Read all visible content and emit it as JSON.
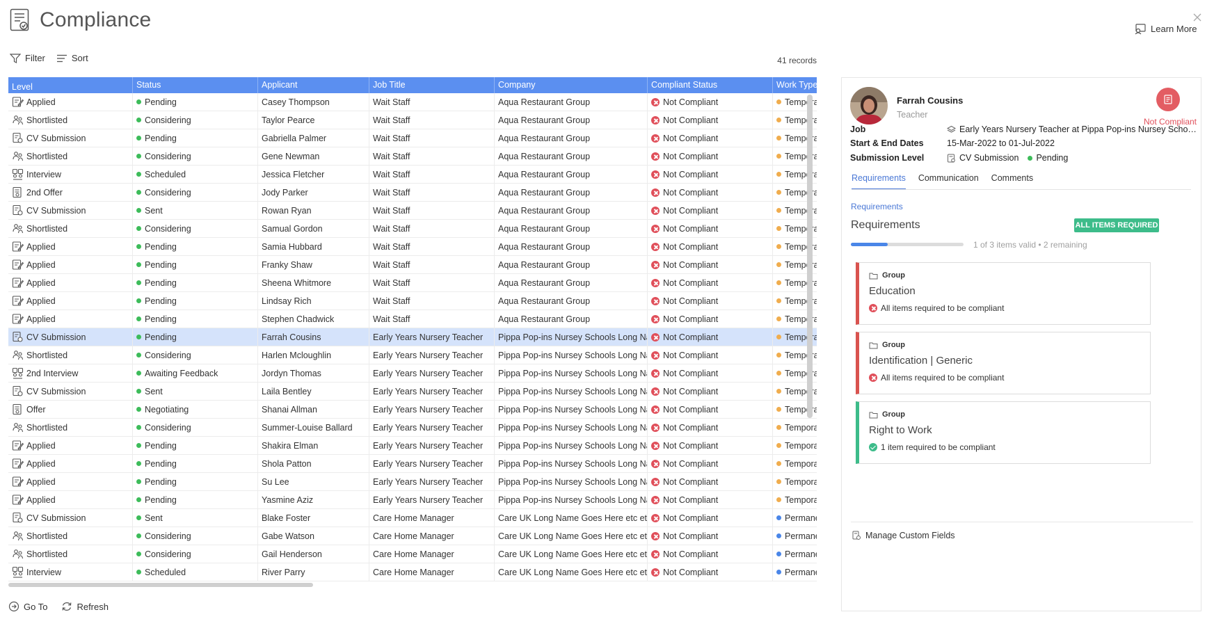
{
  "header": {
    "title": "Compliance",
    "learn_more": "Learn More"
  },
  "toolbar": {
    "filter": "Filter",
    "sort": "Sort",
    "records": "41 records"
  },
  "table": {
    "columns": [
      "Level",
      "Status",
      "Applicant",
      "Job Title",
      "Company",
      "Compliant Status",
      "Work Type"
    ],
    "rows": [
      {
        "level": "Applied",
        "level_icon": "applied-icon",
        "status": "Pending",
        "status_color": "#3dbc5a",
        "applicant": "Casey Thompson",
        "job": "Wait Staff",
        "company": "Aqua Restaurant Group",
        "compliant": "Not Compliant",
        "work": "Temporary",
        "work_color": "#f0ad4e"
      },
      {
        "level": "Shortlisted",
        "level_icon": "shortlisted-icon",
        "status": "Considering",
        "status_color": "#3dbc5a",
        "applicant": "Taylor Pearce",
        "job": "Wait Staff",
        "company": "Aqua Restaurant Group",
        "compliant": "Not Compliant",
        "work": "Temporary",
        "work_color": "#f0ad4e"
      },
      {
        "level": "CV Submission",
        "level_icon": "cv-submission-icon",
        "status": "Pending",
        "status_color": "#3dbc5a",
        "applicant": "Gabriella Palmer",
        "job": "Wait Staff",
        "company": "Aqua Restaurant Group",
        "compliant": "Not Compliant",
        "work": "Temporary",
        "work_color": "#f0ad4e"
      },
      {
        "level": "Shortlisted",
        "level_icon": "shortlisted-icon",
        "status": "Considering",
        "status_color": "#3dbc5a",
        "applicant": "Gene Newman",
        "job": "Wait Staff",
        "company": "Aqua Restaurant Group",
        "compliant": "Not Compliant",
        "work": "Temporary",
        "work_color": "#f0ad4e"
      },
      {
        "level": "Interview",
        "level_icon": "interview-icon",
        "status": "Scheduled",
        "status_color": "#3dbc5a",
        "applicant": "Jessica Fletcher",
        "job": "Wait Staff",
        "company": "Aqua Restaurant Group",
        "compliant": "Not Compliant",
        "work": "Temporary",
        "work_color": "#f0ad4e"
      },
      {
        "level": "2nd Offer",
        "level_icon": "offer-icon",
        "status": "Considering",
        "status_color": "#3dbc5a",
        "applicant": "Jody Parker",
        "job": "Wait Staff",
        "company": "Aqua Restaurant Group",
        "compliant": "Not Compliant",
        "work": "Temporary",
        "work_color": "#f0ad4e"
      },
      {
        "level": "CV Submission",
        "level_icon": "cv-submission-icon",
        "status": "Sent",
        "status_color": "#3dbc5a",
        "applicant": "Rowan Ryan",
        "job": "Wait Staff",
        "company": "Aqua Restaurant Group",
        "compliant": "Not Compliant",
        "work": "Temporary",
        "work_color": "#f0ad4e"
      },
      {
        "level": "Shortlisted",
        "level_icon": "shortlisted-icon",
        "status": "Considering",
        "status_color": "#3dbc5a",
        "applicant": "Samual Gordon",
        "job": "Wait Staff",
        "company": "Aqua Restaurant Group",
        "compliant": "Not Compliant",
        "work": "Temporary",
        "work_color": "#f0ad4e"
      },
      {
        "level": "Applied",
        "level_icon": "applied-icon",
        "status": "Pending",
        "status_color": "#3dbc5a",
        "applicant": "Samia Hubbard",
        "job": "Wait Staff",
        "company": "Aqua Restaurant Group",
        "compliant": "Not Compliant",
        "work": "Temporary",
        "work_color": "#f0ad4e"
      },
      {
        "level": "Applied",
        "level_icon": "applied-icon",
        "status": "Pending",
        "status_color": "#3dbc5a",
        "applicant": "Franky Shaw",
        "job": "Wait Staff",
        "company": "Aqua Restaurant Group",
        "compliant": "Not Compliant",
        "work": "Temporary",
        "work_color": "#f0ad4e"
      },
      {
        "level": "Applied",
        "level_icon": "applied-icon",
        "status": "Pending",
        "status_color": "#3dbc5a",
        "applicant": "Sheena Whitmore",
        "job": "Wait Staff",
        "company": "Aqua Restaurant Group",
        "compliant": "Not Compliant",
        "work": "Temporary",
        "work_color": "#f0ad4e"
      },
      {
        "level": "Applied",
        "level_icon": "applied-icon",
        "status": "Pending",
        "status_color": "#3dbc5a",
        "applicant": "Lindsay Rich",
        "job": "Wait Staff",
        "company": "Aqua Restaurant Group",
        "compliant": "Not Compliant",
        "work": "Temporary",
        "work_color": "#f0ad4e"
      },
      {
        "level": "Applied",
        "level_icon": "applied-icon",
        "status": "Pending",
        "status_color": "#3dbc5a",
        "applicant": "Stephen Chadwick",
        "job": "Wait Staff",
        "company": "Aqua Restaurant Group",
        "compliant": "Not Compliant",
        "work": "Temporary",
        "work_color": "#f0ad4e"
      },
      {
        "level": "CV Submission",
        "level_icon": "cv-submission-icon",
        "status": "Pending",
        "status_color": "#3dbc5a",
        "applicant": "Farrah Cousins",
        "job": "Early Years Nursery Teacher",
        "company": "Pippa Pop-ins Nursey Schools Long Name",
        "compliant": "Not Compliant",
        "work": "Temporary",
        "work_color": "#f0ad4e",
        "selected": true
      },
      {
        "level": "Shortlisted",
        "level_icon": "shortlisted-icon",
        "status": "Considering",
        "status_color": "#3dbc5a",
        "applicant": "Harlen Mcloughlin",
        "job": "Early Years Nursery Teacher",
        "company": "Pippa Pop-ins Nursey Schools Long Name",
        "compliant": "Not Compliant",
        "work": "Temporary",
        "work_color": "#f0ad4e"
      },
      {
        "level": "2nd Interview",
        "level_icon": "interview-icon",
        "status": "Awaiting Feedback",
        "status_color": "#3dbc5a",
        "applicant": "Jordyn Thomas",
        "job": "Early Years Nursery Teacher",
        "company": "Pippa Pop-ins Nursey Schools Long Name",
        "compliant": "Not Compliant",
        "work": "Temporary",
        "work_color": "#f0ad4e"
      },
      {
        "level": "CV Submission",
        "level_icon": "cv-submission-icon",
        "status": "Sent",
        "status_color": "#3dbc5a",
        "applicant": "Laila Bentley",
        "job": "Early Years Nursery Teacher",
        "company": "Pippa Pop-ins Nursey Schools Long Name",
        "compliant": "Not Compliant",
        "work": "Temporary",
        "work_color": "#f0ad4e"
      },
      {
        "level": "Offer",
        "level_icon": "offer-icon",
        "status": "Negotiating",
        "status_color": "#3dbc5a",
        "applicant": "Shanai Allman",
        "job": "Early Years Nursery Teacher",
        "company": "Pippa Pop-ins Nursey Schools Long Name",
        "compliant": "Not Compliant",
        "work": "Temporary",
        "work_color": "#f0ad4e"
      },
      {
        "level": "Shortlisted",
        "level_icon": "shortlisted-icon",
        "status": "Considering",
        "status_color": "#3dbc5a",
        "applicant": "Summer-Louise Ballard",
        "job": "Early Years Nursery Teacher",
        "company": "Pippa Pop-ins Nursey Schools Long Name",
        "compliant": "Not Compliant",
        "work": "Temporary",
        "work_color": "#f0ad4e"
      },
      {
        "level": "Applied",
        "level_icon": "applied-icon",
        "status": "Pending",
        "status_color": "#3dbc5a",
        "applicant": "Shakira Elman",
        "job": "Early Years Nursery Teacher",
        "company": "Pippa Pop-ins Nursey Schools Long Name",
        "compliant": "Not Compliant",
        "work": "Temporary",
        "work_color": "#f0ad4e"
      },
      {
        "level": "Applied",
        "level_icon": "applied-icon",
        "status": "Pending",
        "status_color": "#3dbc5a",
        "applicant": "Shola Patton",
        "job": "Early Years Nursery Teacher",
        "company": "Pippa Pop-ins Nursey Schools Long Name",
        "compliant": "Not Compliant",
        "work": "Temporary",
        "work_color": "#f0ad4e"
      },
      {
        "level": "Applied",
        "level_icon": "applied-icon",
        "status": "Pending",
        "status_color": "#3dbc5a",
        "applicant": "Su Lee",
        "job": "Early Years Nursery Teacher",
        "company": "Pippa Pop-ins Nursey Schools Long Name",
        "compliant": "Not Compliant",
        "work": "Temporary",
        "work_color": "#f0ad4e"
      },
      {
        "level": "Applied",
        "level_icon": "applied-icon",
        "status": "Pending",
        "status_color": "#3dbc5a",
        "applicant": "Yasmine Aziz",
        "job": "Early Years Nursery Teacher",
        "company": "Pippa Pop-ins Nursey Schools Long Name",
        "compliant": "Not Compliant",
        "work": "Temporary",
        "work_color": "#f0ad4e"
      },
      {
        "level": "CV Submission",
        "level_icon": "cv-submission-icon",
        "status": "Sent",
        "status_color": "#3dbc5a",
        "applicant": "Blake Foster",
        "job": "Care Home Manager",
        "company": "Care UK Long Name Goes Here etc etc",
        "compliant": "Not Compliant",
        "work": "Permanent",
        "work_color": "#4a86e8"
      },
      {
        "level": "Shortlisted",
        "level_icon": "shortlisted-icon",
        "status": "Considering",
        "status_color": "#3dbc5a",
        "applicant": "Gabe Watson",
        "job": "Care Home Manager",
        "company": "Care UK Long Name Goes Here etc etc",
        "compliant": "Not Compliant",
        "work": "Permanent",
        "work_color": "#4a86e8"
      },
      {
        "level": "Shortlisted",
        "level_icon": "shortlisted-icon",
        "status": "Considering",
        "status_color": "#3dbc5a",
        "applicant": "Gail Henderson",
        "job": "Care Home Manager",
        "company": "Care UK Long Name Goes Here etc etc",
        "compliant": "Not Compliant",
        "work": "Permanent",
        "work_color": "#4a86e8"
      },
      {
        "level": "Interview",
        "level_icon": "interview-icon",
        "status": "Scheduled",
        "status_color": "#3dbc5a",
        "applicant": "River Parry",
        "job": "Care Home Manager",
        "company": "Care UK Long Name Goes Here etc etc",
        "compliant": "Not Compliant",
        "work": "Permanent",
        "work_color": "#4a86e8"
      }
    ]
  },
  "footer": {
    "goto": "Go To",
    "refresh": "Refresh"
  },
  "panel": {
    "name": "Farrah Cousins",
    "role": "Teacher",
    "compliance_label": "Not Compliant",
    "job_label": "Job",
    "job_value": "Early Years Nursery Teacher at Pippa Pop-ins Nursey Schools Long Name",
    "dates_label": "Start & End Dates",
    "dates_value": "15-Mar-2022 to 01-Jul-2022",
    "submission_label": "Submission Level",
    "submission_level": "CV Submission",
    "submission_status": "Pending",
    "tabs": [
      "Requirements",
      "Communication",
      "Comments"
    ],
    "req_link": "Requirements",
    "req_title": "Requirements",
    "req_badge": "ALL ITEMS REQUIRED",
    "progress_fraction": 0.33,
    "progress_text": "1 of 3 items valid • 2 remaining",
    "groups": [
      {
        "label": "Group",
        "title": "Education",
        "note": "All items required to be compliant",
        "ok": false
      },
      {
        "label": "Group",
        "title": "Identification | Generic",
        "note": "All items required to be compliant",
        "ok": false
      },
      {
        "label": "Group",
        "title": "Right to Work",
        "note": "1 item required to be compliant",
        "ok": true
      }
    ],
    "manage": "Manage Custom Fields"
  },
  "colors": {
    "header_blue": "#5b8ff0",
    "accent_green": "#3dbc8a",
    "error_red": "#e04f5a",
    "link_blue": "#4a78d6"
  }
}
